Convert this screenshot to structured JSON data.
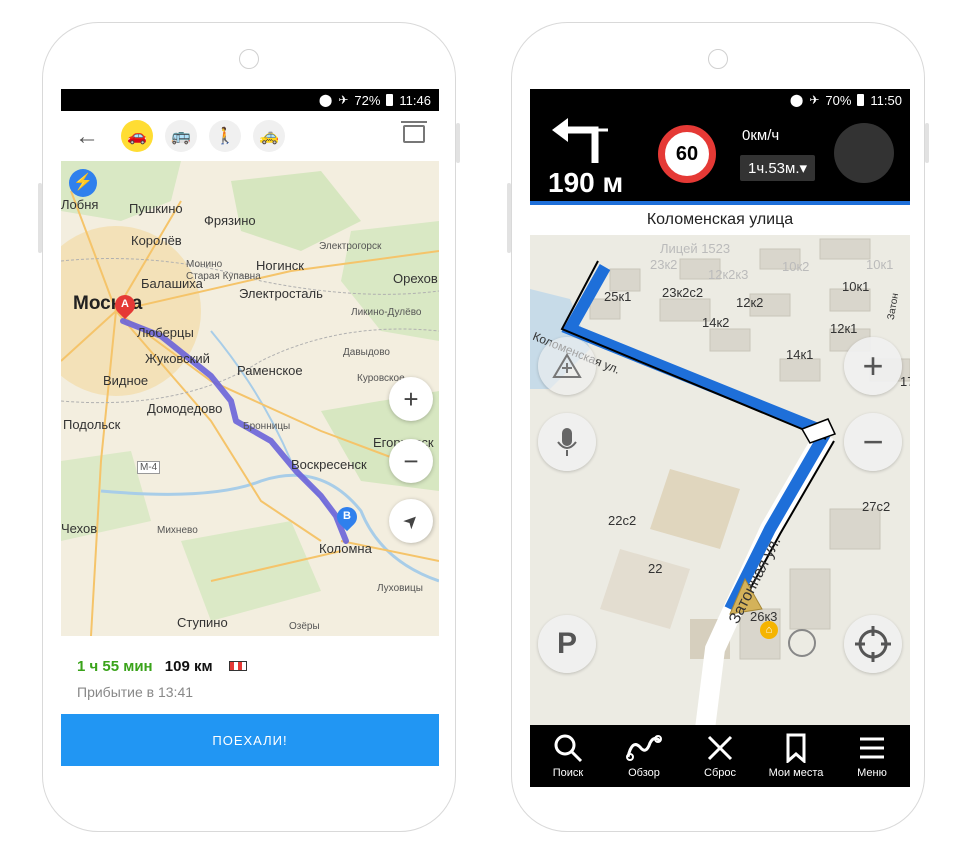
{
  "left_phone": {
    "status": {
      "battery": "72%",
      "time": "11:46"
    },
    "toolbar": {
      "back": "←",
      "modes": [
        {
          "name": "car",
          "icon": "🚗",
          "active": true
        },
        {
          "name": "bus",
          "icon": "🚌",
          "active": false
        },
        {
          "name": "walk",
          "icon": "🚶",
          "active": false
        },
        {
          "name": "taxi",
          "icon": "🚕",
          "active": false
        }
      ]
    },
    "map": {
      "labels": {
        "lobnya": "Лобня",
        "pushkino": "Пушкино",
        "fryazino": "Фрязино",
        "korolev": "Королёв",
        "elektrogorsk": "Электрогорск",
        "monino": "Монино",
        "noginsk": "Ногинск",
        "balashikha": "Балашиха",
        "staraya_kupavna": "Старая Купавна",
        "orekhovo": "Орехов",
        "moscow": "Москва",
        "elektrostal": "Электросталь",
        "lyubertsy": "Люберцы",
        "likino": "Ликино-Дулёво",
        "zhukovsky": "Жуковский",
        "davydovo": "Давыдово",
        "vidnoe": "Видное",
        "ramenskoe": "Раменское",
        "kurovskoe": "Куровское",
        "domodedovo": "Домодедово",
        "bronnitsy": "Бронницы",
        "podolsk": "Подольск",
        "egoryevsk": "Егорьевск",
        "voskresensk": "Воскресенск",
        "m4": "M-4",
        "chekhov": "Чехов",
        "mikhnevo": "Михнево",
        "kolomna": "Коломна",
        "lukhovitsy": "Луховицы",
        "stupino": "Ступино",
        "ozery": "Озёры"
      },
      "pin_a": "A",
      "pin_b": "B",
      "zoom_in": "+",
      "zoom_out": "−",
      "locate": "➤"
    },
    "route": {
      "duration": "1 ч 55 мин",
      "distance": "109 км",
      "arrival": "Прибытие в 13:41"
    },
    "go_button": "ПОЕХАЛИ!",
    "colors": {
      "route": "#6a63d9",
      "accent": "#2196f3",
      "duration": "#3aa31a"
    }
  },
  "right_phone": {
    "status": {
      "battery": "70%",
      "time": "11:50"
    },
    "nav": {
      "distance": "190 м",
      "speed_limit": "60",
      "speed": "0км/ч",
      "eta": "1ч.53м."
    },
    "street": "Коломенская улица",
    "map_labels": {
      "litsey": "Лицей 1523",
      "b23k2": "23к2",
      "b12k2k3": "12к2к3",
      "b10k2": "10к2",
      "b10k1_top": "10к1",
      "b25k1": "25к1",
      "b23k2c2": "23к2с2",
      "b12k2": "12к2",
      "b10k1": "10к1",
      "b14k2": "14к2",
      "b12k1": "12к1",
      "b14k1": "14к1",
      "kolomenskaya": "Коломенская ул.",
      "b27c2": "27с2",
      "b22c2": "22с2",
      "b22": "22",
      "zatonnaya": "Затонная ул.",
      "b26k3": "26к3",
      "b17": "17",
      "zaton": "Затон"
    },
    "controls": {
      "zoom_in": "+",
      "zoom_out": "−",
      "parking": "P"
    },
    "bottom_nav": [
      {
        "label": "Поиск",
        "icon": "search-icon"
      },
      {
        "label": "Обзор",
        "icon": "overview-icon"
      },
      {
        "label": "Сброс",
        "icon": "reset-icon"
      },
      {
        "label": "Мои места",
        "icon": "bookmark-icon"
      },
      {
        "label": "Меню",
        "icon": "menu-icon"
      }
    ],
    "colors": {
      "route": "#1e6fd9",
      "speed_ring": "#e53935"
    }
  }
}
